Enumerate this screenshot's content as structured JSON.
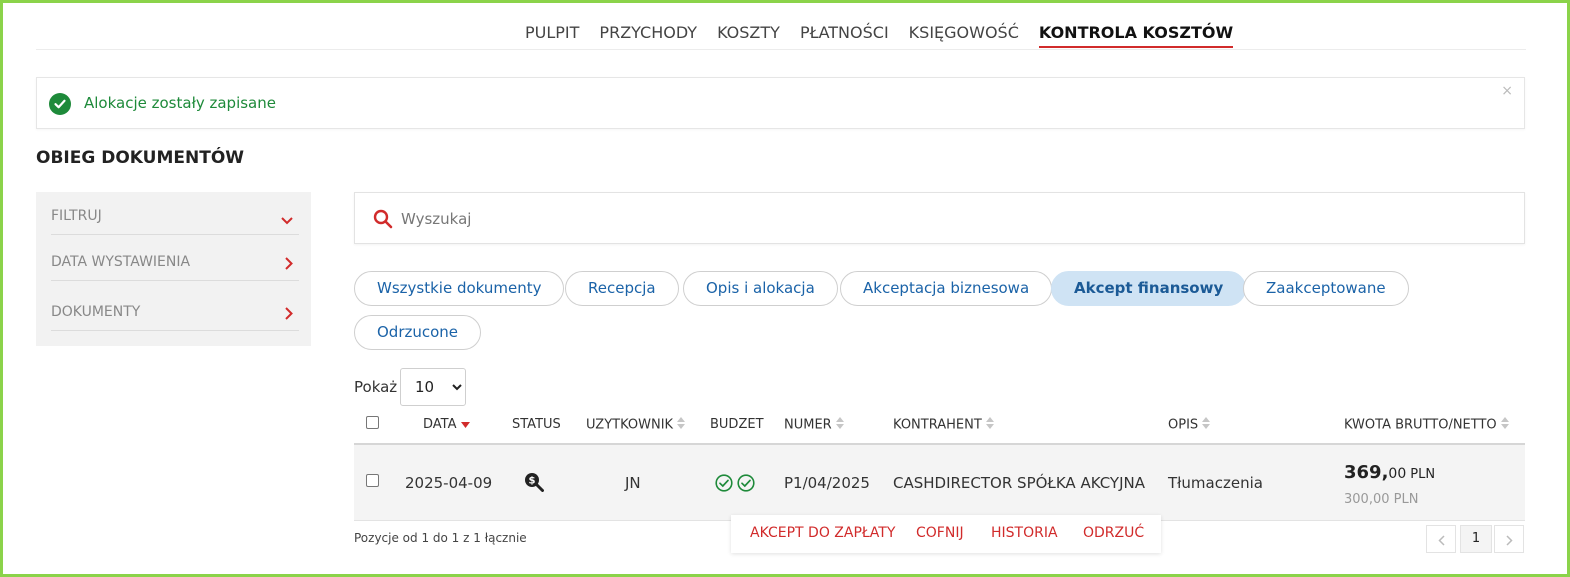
{
  "nav": {
    "items": [
      {
        "label": "PULPIT"
      },
      {
        "label": "PRZYCHODY"
      },
      {
        "label": "KOSZTY"
      },
      {
        "label": "PŁATNOŚCI"
      },
      {
        "label": "KSIĘGOWOŚĆ"
      },
      {
        "label": "KONTROLA KOSZTÓW",
        "active": true
      }
    ]
  },
  "alert": {
    "message": "Alokacje zostały zapisane",
    "close": "×",
    "icon": "check-circle-icon",
    "color": "#1e8a3a"
  },
  "page_title": "OBIEG DOKUMENTÓW",
  "sidebar": {
    "items": [
      {
        "label": "FILTRUJ",
        "icon": "chevron-down-icon"
      },
      {
        "label": "DATA WYSTAWIENIA",
        "icon": "chevron-right-icon"
      },
      {
        "label": "DOKUMENTY",
        "icon": "chevron-right-icon"
      }
    ]
  },
  "search": {
    "placeholder": "Wyszukaj",
    "value": "",
    "icon": "search-icon"
  },
  "filters": {
    "pills": [
      {
        "label": "Wszystkie dokumenty"
      },
      {
        "label": "Recepcja"
      },
      {
        "label": "Opis i alokacja"
      },
      {
        "label": "Akceptacja biznesowa"
      },
      {
        "label": "Akcept finansowy",
        "active": true
      },
      {
        "label": "Zaakceptowane"
      },
      {
        "label": "Odrzucone"
      }
    ]
  },
  "show": {
    "label": "Pokaż",
    "selected": "10"
  },
  "table": {
    "headers": {
      "date": "DATA",
      "status": "STATUS",
      "user": "UZYTKOWNIK",
      "budget": "BUDZET",
      "number": "NUMER",
      "contractor": "KONTRAHENT",
      "description": "OPIS",
      "amount": "KWOTA BRUTTO/NETTO"
    },
    "rows": [
      {
        "date": "2025-04-09",
        "status_icon": "search-dollar-icon",
        "user": "JN",
        "budget_icons": [
          "check-circle-icon",
          "check-circle-icon"
        ],
        "number": "P1/04/2025",
        "contractor": "CASHDIRECTOR SPÓŁKA AKCYJNA",
        "description": "Tłumaczenia",
        "gross_int": "369,",
        "gross_dec": "00",
        "gross_cur": "PLN",
        "net": "300,00 PLN"
      }
    ]
  },
  "footer": {
    "info": "Pozycje od 1 do 1 z 1 łącznie",
    "page": "1"
  },
  "actions": {
    "accept": "AKCEPT DO ZAPŁATY",
    "undo": "COFNIJ",
    "history": "HISTORIA",
    "reject": "ODRZUĆ"
  },
  "colors": {
    "accent_red": "#d12b2b",
    "link_blue": "#1b63a8",
    "success_green": "#1e8a3a",
    "frame_green": "#8bd34a"
  }
}
